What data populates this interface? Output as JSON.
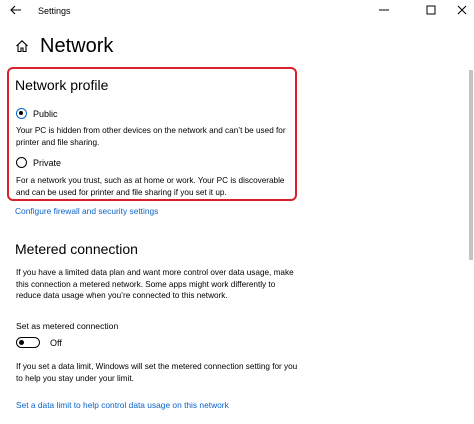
{
  "window": {
    "title": "Settings",
    "controls": [
      "minimize-icon",
      "maximize-icon",
      "close-icon"
    ]
  },
  "header": {
    "title": "Network"
  },
  "network_profile": {
    "title": "Network profile",
    "options": [
      {
        "label": "Public",
        "selected": true,
        "description": "Your PC is hidden from other devices on the network and can’t be used for printer and file sharing."
      },
      {
        "label": "Private",
        "selected": false,
        "description": "For a network you trust, such as at home or work. Your PC is discoverable and can be used for printer and file sharing if you set it up."
      }
    ],
    "firewall_link": "Configure firewall and security settings"
  },
  "metered": {
    "title": "Metered connection",
    "description": "If you have a limited data plan and want more control over data usage, make this connection a metered network. Some apps might work differently to reduce data usage when you’re connected to this network.",
    "toggle_label": "Set as metered connection",
    "toggle_state": "Off",
    "toggle_on": false,
    "limit_description": "If you set a data limit, Windows will set the metered connection setting for you to help you stay under your limit.",
    "limit_link": "Set a data limit to help control data usage on this network"
  },
  "colors": {
    "accent": "#0a63c9",
    "highlight_border": "#d9202b"
  }
}
